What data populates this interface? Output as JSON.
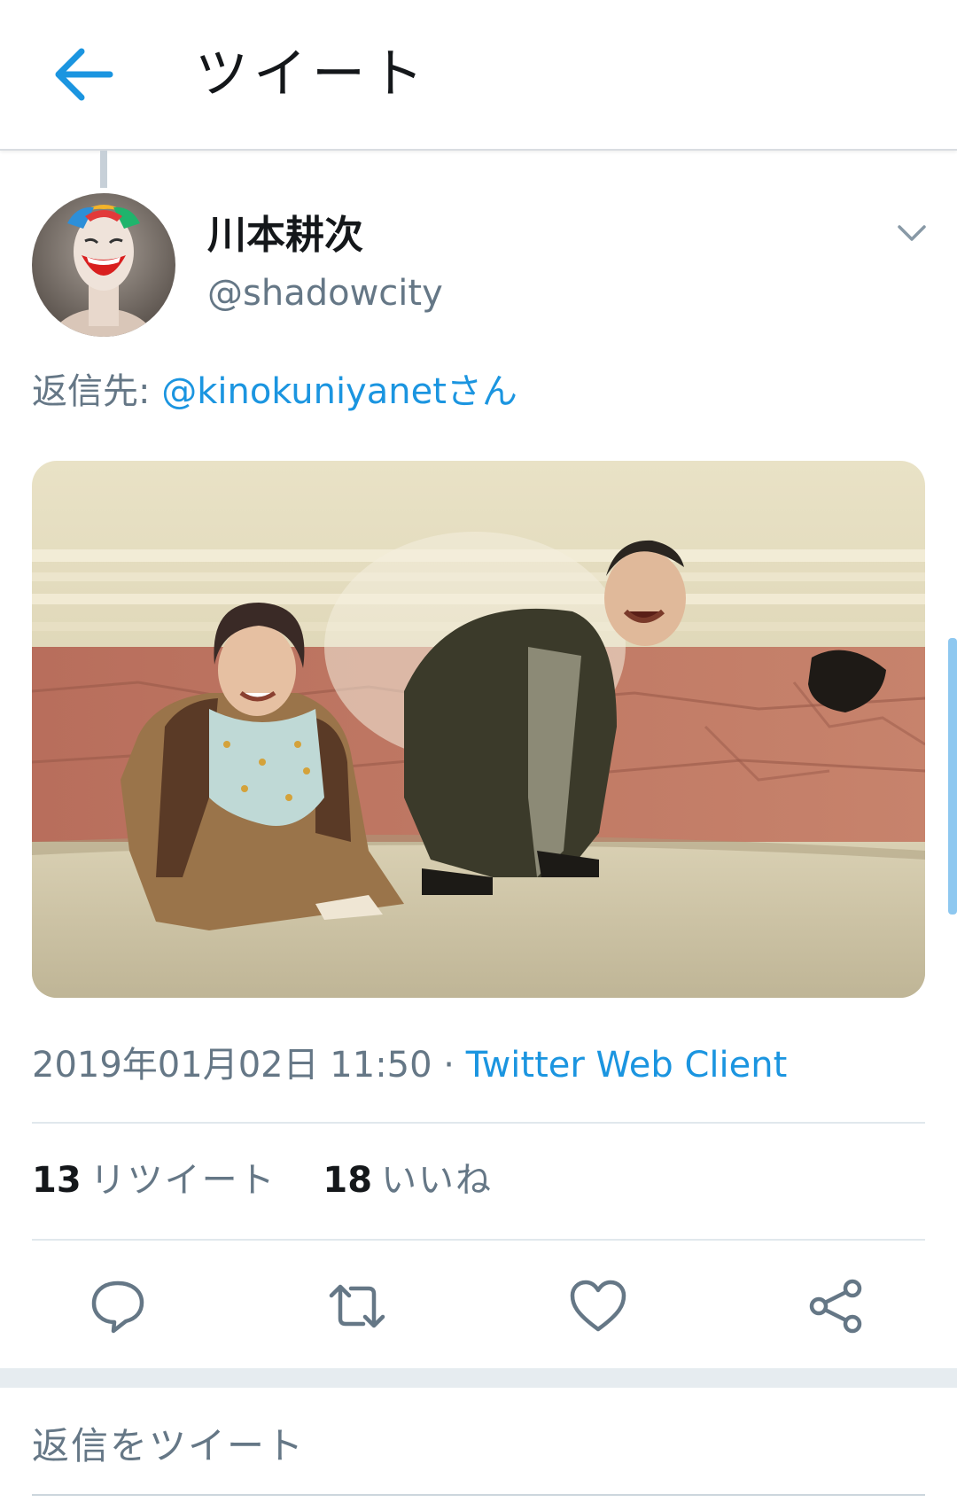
{
  "header": {
    "title": "ツイート",
    "back_icon": "arrow-left-icon"
  },
  "tweet": {
    "display_name": "川本耕次",
    "handle": "@shadowcity",
    "reply_prefix": "返信先: ",
    "reply_to": "@kinokuniyanetさん",
    "timestamp": "2019年01月02日 11:50",
    "separator": " · ",
    "source": "Twitter Web Client",
    "retweet_count": "13",
    "retweet_label": "リツイート",
    "like_count": "18",
    "like_label": "いいね"
  },
  "actions": {
    "reply_icon": "reply-icon",
    "retweet_icon": "retweet-icon",
    "like_icon": "heart-icon",
    "share_icon": "share-icon"
  },
  "compose": {
    "placeholder": "返信をツイート"
  },
  "colors": {
    "accent": "#1b95e0",
    "secondary_text": "#657786",
    "primary_text": "#14171a",
    "divider": "#e1e8ed"
  }
}
